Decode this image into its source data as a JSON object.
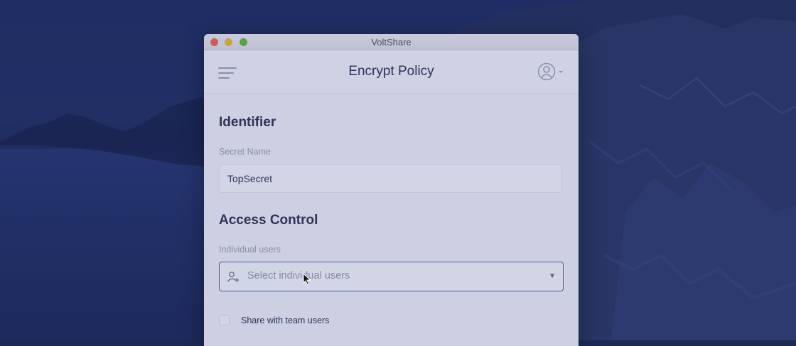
{
  "window": {
    "title": "VoltShare"
  },
  "appbar": {
    "title": "Encrypt Policy",
    "menu_icon": "hamburger-menu-icon",
    "account_icon": "user-circle-icon"
  },
  "identifier": {
    "heading": "Identifier",
    "secret_name_label": "Secret Name",
    "secret_name_value": "TopSecret"
  },
  "access_control": {
    "heading": "Access Control",
    "individual_users_label": "Individual users",
    "individual_users_placeholder": "Select individual users",
    "share_team_label": "Share with team users",
    "share_team_checked": false
  },
  "colors": {
    "accent": "#4c55a6",
    "close": "#cf5a57",
    "minimize": "#c9a43e",
    "maximize": "#5aa04c"
  }
}
